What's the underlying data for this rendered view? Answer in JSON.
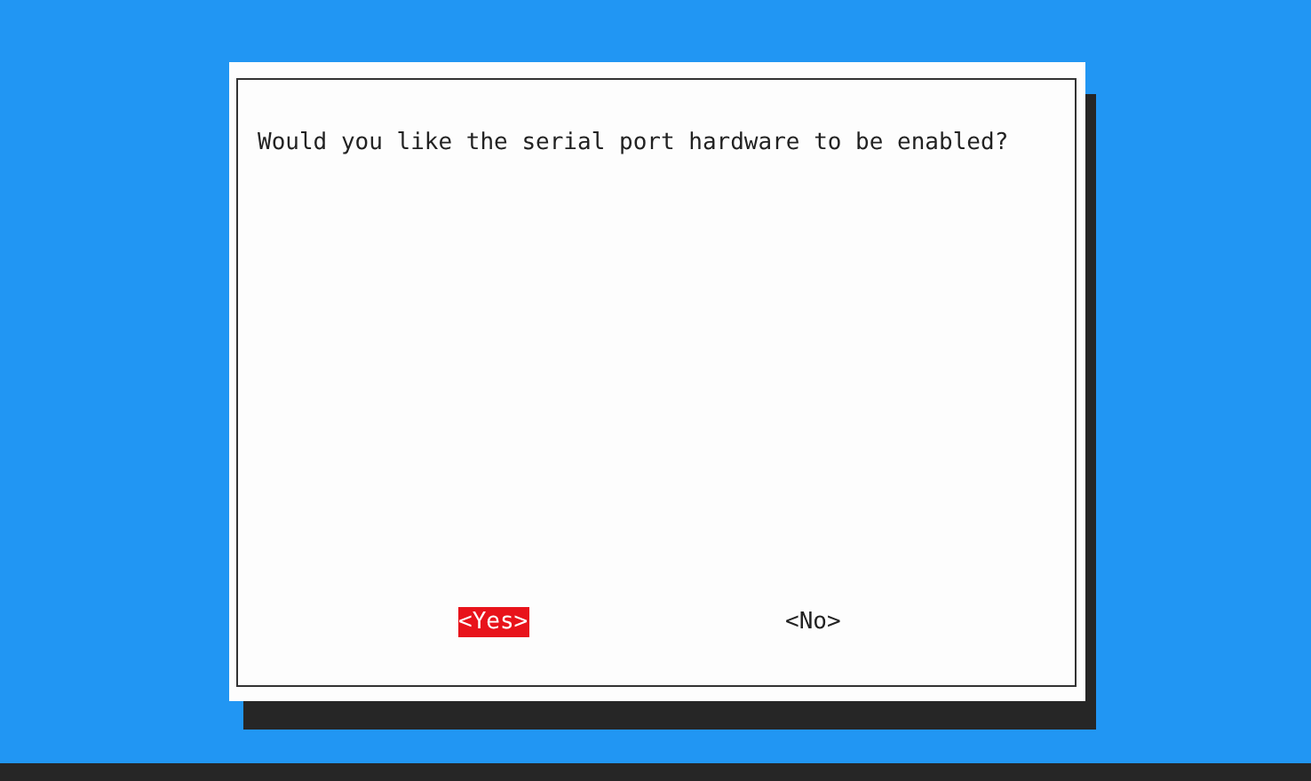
{
  "dialog": {
    "message": "Would you like the serial port hardware to be enabled?",
    "buttons": [
      {
        "label": "<Yes>",
        "selected": true
      },
      {
        "label": "<No>",
        "selected": false
      }
    ]
  }
}
